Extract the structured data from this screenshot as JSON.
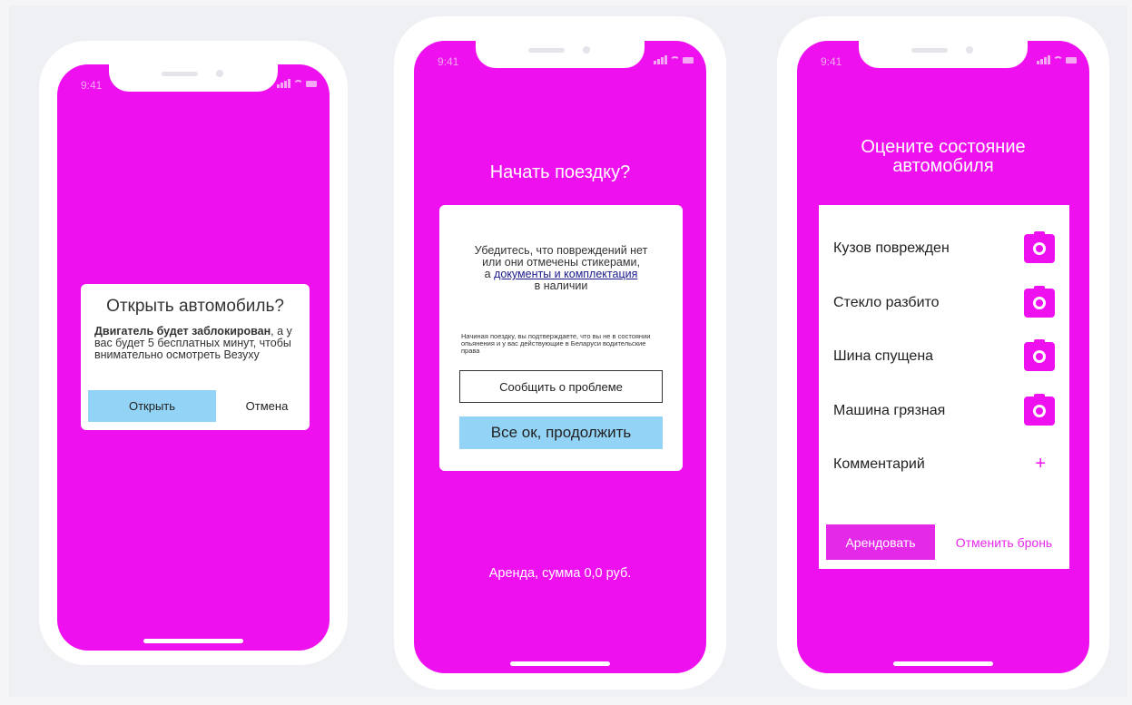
{
  "status_time": "9:41",
  "phone1": {
    "dialog": {
      "title": "Открыть автомобиль?",
      "body_bold": "Двигатель будет заблокирован",
      "body_rest": ", а у вас будет 5 бесплатных минут, чтобы внимательно осмотреть Везуху",
      "open_button": "Открыть",
      "cancel_button": "Отмена"
    }
  },
  "phone2": {
    "title": "Начать поездку?",
    "check_line1": "Убедитесь, что повреждений нет",
    "check_line2": "или они отмечены стикерами,",
    "check_prefix": "а ",
    "check_link": "документы и комплектация",
    "check_line4": "в наличии",
    "disclaimer": "Начиная поездку, вы подтверждаете, что вы не в состоянии опьянения и у вас действующие в Беларуси водительские права",
    "report_button": "Сообщить о проблеме",
    "continue_button": "Все ок, продолжить",
    "rent_sum": "Аренда, сумма 0,0 руб."
  },
  "phone3": {
    "title_line1": "Оцените состояние",
    "title_line2": "автомобиля",
    "items": [
      {
        "label": "Кузов поврежден",
        "icon": "camera-icon"
      },
      {
        "label": "Стекло разбито",
        "icon": "camera-icon"
      },
      {
        "label": "Шина спущена",
        "icon": "camera-icon"
      },
      {
        "label": "Машина грязная",
        "icon": "camera-icon"
      }
    ],
    "comment_label": "Комментарий",
    "comment_icon": "plus-icon",
    "rent_button": "Арендовать",
    "cancel_booking_button": "Отменить бронь"
  },
  "colors": {
    "screen_bg": "#ee10ee",
    "accent_blue": "#93d3f6",
    "accent_magenta": "#e529e9"
  }
}
